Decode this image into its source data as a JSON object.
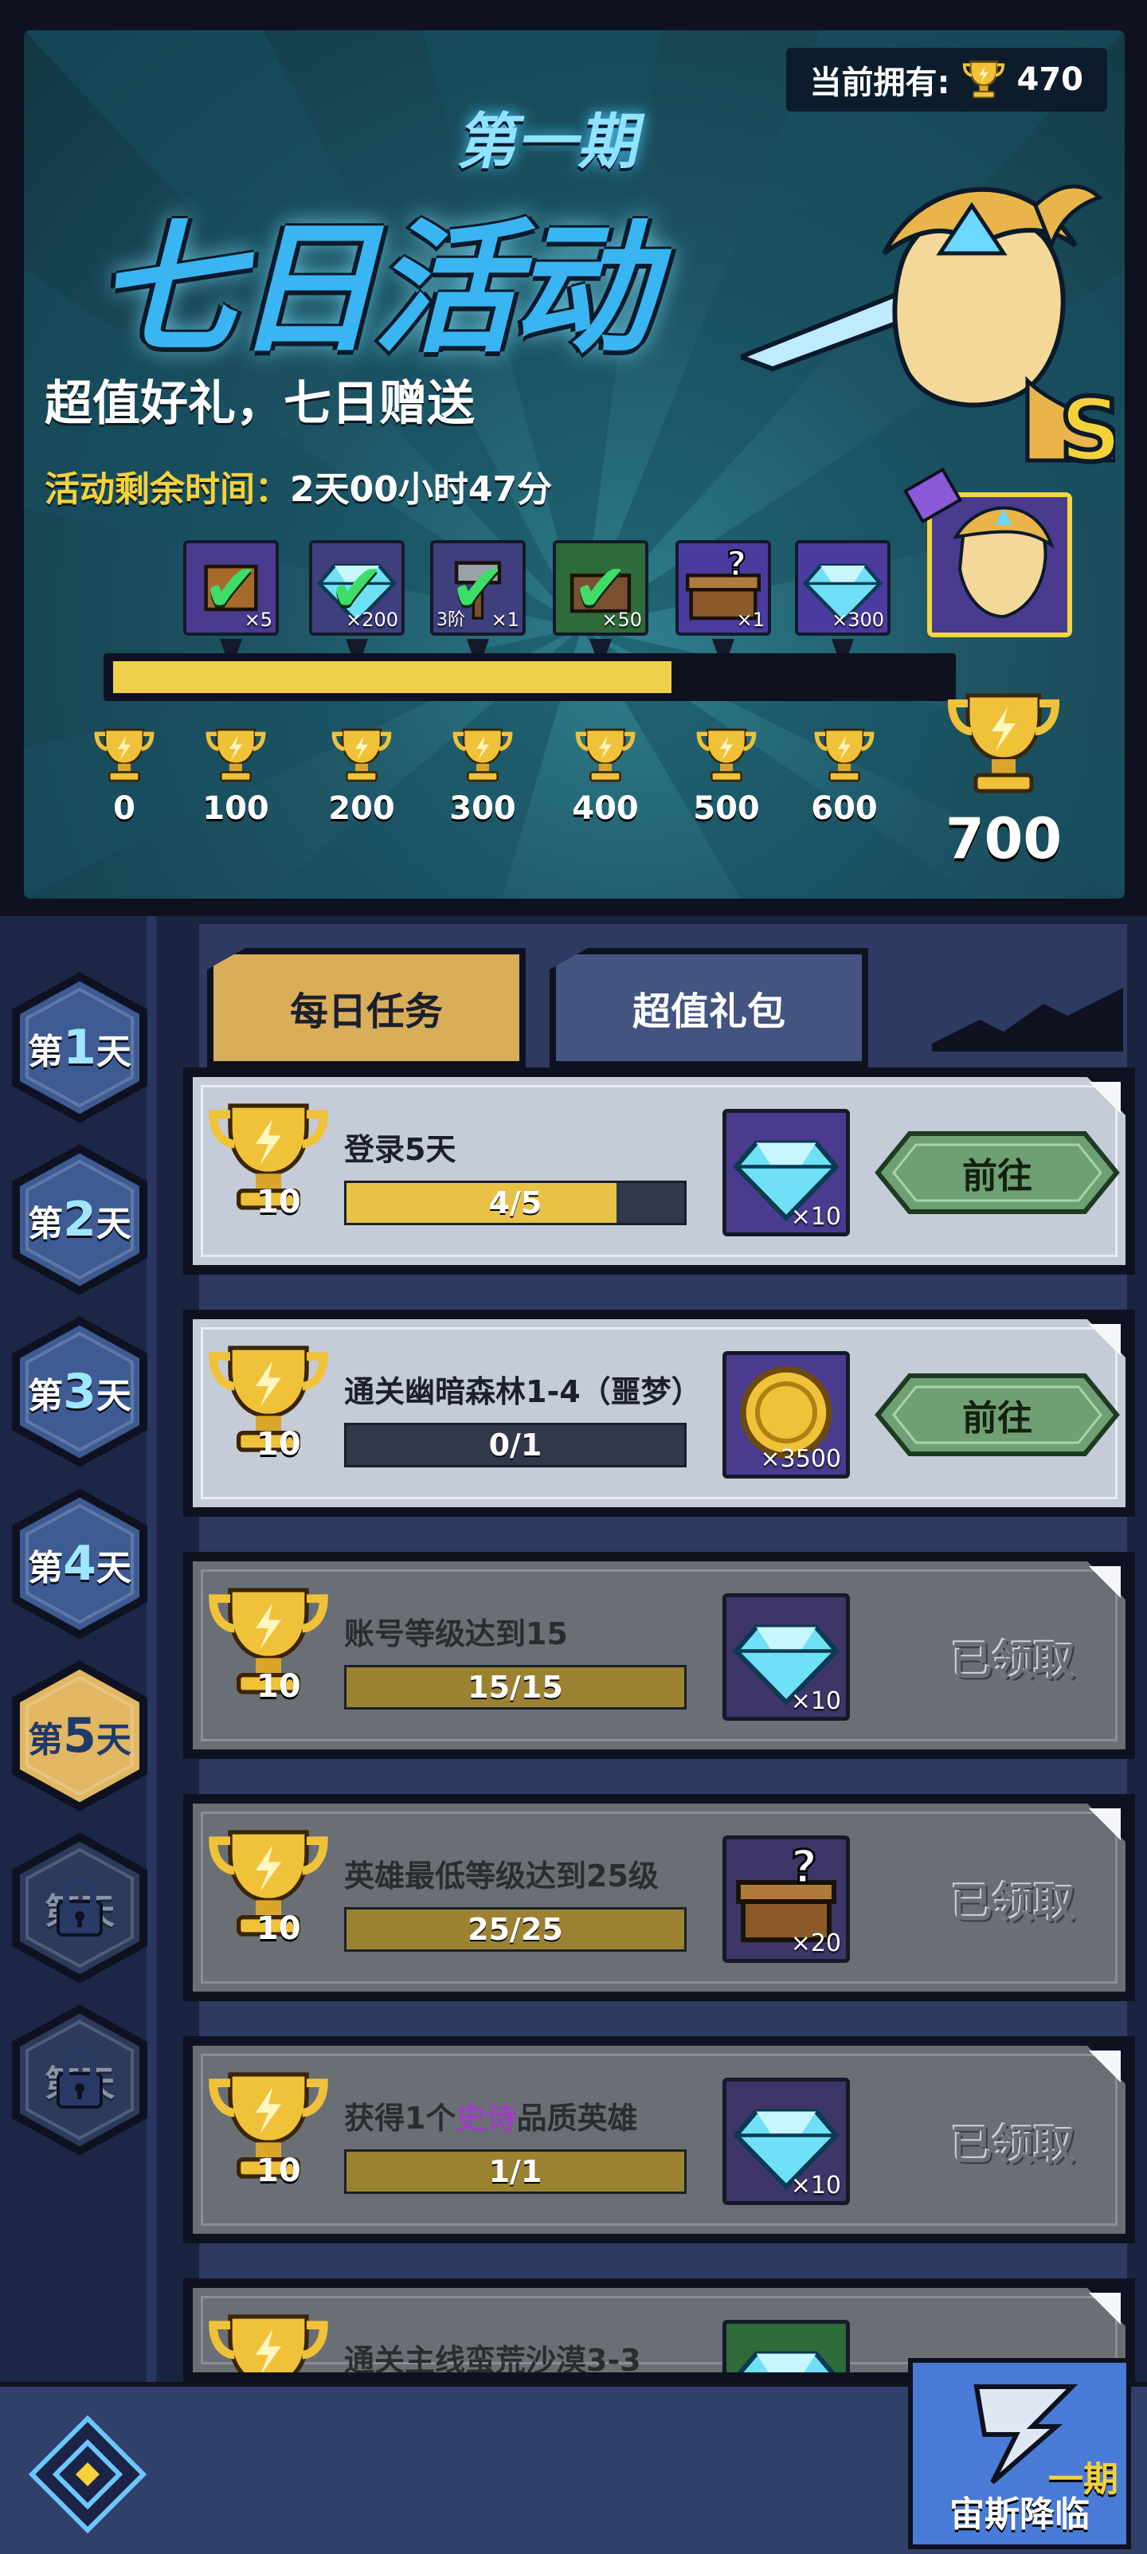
{
  "banner": {
    "season": "第一期",
    "title": "七日活动",
    "owned_label": "当前拥有:",
    "owned_value": "470",
    "slogan": "超值好礼，七日赠送",
    "timer_label": "活动剩余时间：",
    "timer_value": "2天00小时47分",
    "hero_rank": "S",
    "progress_fraction": 0.67,
    "rewards": [
      {
        "count": "×5",
        "claimed": true,
        "color": "#4a3b8e",
        "icon": "scroll-icon"
      },
      {
        "count": "×200",
        "claimed": true,
        "color": "#3e3f7c",
        "icon": "diamond-icon"
      },
      {
        "count": "×1",
        "tier": "3阶",
        "claimed": true,
        "color": "#3e3f7c",
        "icon": "hammer-icon"
      },
      {
        "count": "×50",
        "claimed": true,
        "color": "#2f6a3a",
        "icon": "chest-icon"
      },
      {
        "count": "×1",
        "claimed": false,
        "color": "#4b3b9e",
        "icon": "mystery-chest-icon"
      },
      {
        "count": "×300",
        "claimed": false,
        "color": "#4b3b9e",
        "icon": "diamond-icon"
      }
    ],
    "milestones": [
      "0",
      "100",
      "200",
      "300",
      "400",
      "500",
      "600"
    ],
    "final_milestone": "700"
  },
  "days": [
    {
      "prefix": "第",
      "num": "1",
      "suffix": "天",
      "state": "normal"
    },
    {
      "prefix": "第",
      "num": "2",
      "suffix": "天",
      "state": "normal"
    },
    {
      "prefix": "第",
      "num": "3",
      "suffix": "天",
      "state": "normal"
    },
    {
      "prefix": "第",
      "num": "4",
      "suffix": "天",
      "state": "normal"
    },
    {
      "prefix": "第",
      "num": "5",
      "suffix": "天",
      "state": "active"
    },
    {
      "prefix": "第",
      "num": "",
      "suffix": "天",
      "state": "locked"
    },
    {
      "prefix": "第",
      "num": "",
      "suffix": "天",
      "state": "locked"
    }
  ],
  "tabs": {
    "daily": "每日任务",
    "pack": "超值礼包"
  },
  "tasks": [
    {
      "points": "10",
      "name": "登录5天",
      "progress": "4/5",
      "fill": 0.8,
      "reward_count": "×10",
      "reward_icon": "diamond-icon",
      "status": "open",
      "action": "前往"
    },
    {
      "points": "10",
      "name": "通关幽暗森林1-4（噩梦）",
      "progress": "0/1",
      "fill": 0,
      "reward_count": "×3500",
      "reward_icon": "gold-coin-icon",
      "status": "open",
      "action": "前往"
    },
    {
      "points": "10",
      "name": "账号等级达到15",
      "progress": "15/15",
      "fill": 1,
      "reward_count": "×10",
      "reward_icon": "diamond-icon",
      "status": "done",
      "action": "已领取"
    },
    {
      "points": "10",
      "name": "英雄最低等级达到25级",
      "progress": "25/25",
      "fill": 1,
      "reward_count": "×20",
      "reward_icon": "mystery-chest-icon",
      "status": "done",
      "action": "已领取"
    },
    {
      "points": "10",
      "name_parts": [
        "获得1个",
        "史诗",
        "品质英雄"
      ],
      "progress": "1/1",
      "fill": 1,
      "reward_count": "×10",
      "reward_icon": "diamond-icon",
      "status": "done",
      "action": "已领取"
    },
    {
      "points": "",
      "name": "通关主线蛮荒沙漠3-3",
      "progress": "",
      "fill": 0,
      "reward_count": "",
      "reward_icon": "gem-icon",
      "status": "partial",
      "action": ""
    }
  ],
  "bottom": {
    "zeus_label": "宙斯降临",
    "zeus_period": "一期"
  },
  "colors": {
    "gold": "#f0cf4c",
    "go_button": "#6fa073",
    "active_tab": "#d9ae5a",
    "inactive_tab": "#44537f",
    "epic": "#9c3fc1"
  }
}
